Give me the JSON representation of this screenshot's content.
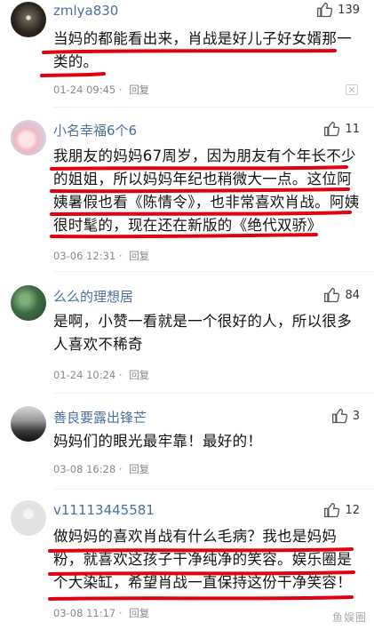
{
  "comments": [
    {
      "username": "zmlya830",
      "likes": "139",
      "text": "当妈的都能看出来，肖战是好儿子好女婿那一类的。",
      "time": "01-24 09:45",
      "reply_label": "回复"
    },
    {
      "username": "小名幸福6个6",
      "likes": "11",
      "text": "我朋友的妈妈67周岁，因为朋友有个年长不少的姐姐，所以妈妈年纪也稍微大一点。这位阿姨暑假也看《陈情令》，也非常喜欢肖战。阿姨很时髦的，现在还在新版的《绝代双骄》",
      "time": "03-06 12:31",
      "reply_label": "回复"
    },
    {
      "username": "么么的理想居",
      "likes": "84",
      "text": "是啊，小赞一看就是一个很好的人，所以很多人喜欢不稀奇",
      "time": "01-24 10:24",
      "reply_label": "回复"
    },
    {
      "username": "善良要露出锋芒",
      "likes": "3",
      "text": "妈妈们的眼光最牢靠！最好的！",
      "time": "03-08 16:28",
      "reply_label": "回复"
    },
    {
      "username": "v11113445581",
      "likes": "12",
      "text": "做妈妈的喜欢肖战有什么毛病？我也是妈妈粉，就喜欢这孩子干净纯净的笑容。娱乐圈是个大染缸，希望肖战一直保持这份干净笑容！",
      "time": "03-08 11:17",
      "reply_label": "回复"
    }
  ],
  "watermark": "鱼娱圈",
  "colors": {
    "username": "#4a6f9c",
    "underline": "#e0000f",
    "meta": "#888888"
  }
}
